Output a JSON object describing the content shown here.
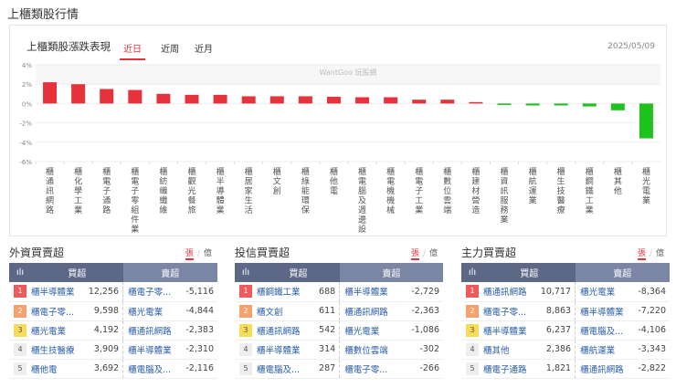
{
  "page_title": "上櫃類股行情",
  "card": {
    "title": "上櫃類股漲跌表現",
    "tabs": [
      "近日",
      "近周",
      "近月"
    ],
    "active_tab": 0,
    "date": "2025/05/09",
    "watermark": "WantGoo 玩股網"
  },
  "chart_data": {
    "type": "bar",
    "ylim": [
      -6,
      4
    ],
    "yticks": [
      "4%",
      "2%",
      "0%",
      "-2%",
      "-4%",
      "-6%"
    ],
    "ytick_values": [
      4,
      2,
      0,
      -2,
      -4,
      -6
    ],
    "categories": [
      "櫃通訊網路",
      "櫃化學工業",
      "櫃電子通路",
      "櫃電子零組件業",
      "櫃紡織纖維",
      "櫃觀光餐旅",
      "櫃半導體業",
      "櫃居家生活",
      "櫃文創",
      "櫃綠能環保",
      "櫃他電",
      "櫃電腦及週邊設",
      "櫃電機機械",
      "櫃電子工業",
      "櫃數位雲端",
      "櫃建材營造",
      "櫃資訊服務業",
      "櫃航運業",
      "櫃生技醫療",
      "櫃鋼鐵工業",
      "櫃其他",
      "櫃光電業"
    ],
    "values": [
      2.2,
      2.0,
      1.5,
      1.4,
      1.0,
      0.9,
      0.9,
      0.75,
      0.75,
      0.75,
      0.7,
      0.65,
      0.65,
      0.4,
      0.4,
      0.15,
      -0.15,
      -0.2,
      -0.2,
      -0.3,
      -0.7,
      -3.6
    ],
    "colors": {
      "up": "#e5323c",
      "down": "#1ec31e"
    }
  },
  "unit": {
    "on": "張",
    "sep": "/",
    "off": "億"
  },
  "sections": [
    {
      "title": "外資買賣超",
      "h_icon": "ılı",
      "h_buy": "買超",
      "h_sell": "賣超",
      "rows": [
        [
          "1",
          "櫃半導體業",
          "12,256",
          "櫃電子零...",
          "-5,116"
        ],
        [
          "2",
          "櫃電子零...",
          "9,598",
          "櫃光電業",
          "-4,844"
        ],
        [
          "3",
          "櫃光電業",
          "4,192",
          "櫃通訊網路",
          "-2,383"
        ],
        [
          "4",
          "櫃生技醫療",
          "3,909",
          "櫃半導體業",
          "-2,310"
        ],
        [
          "5",
          "櫃他電",
          "3,692",
          "櫃電腦及...",
          "-2,116"
        ]
      ]
    },
    {
      "title": "投信買賣超",
      "h_icon": "ılı",
      "h_buy": "買超",
      "h_sell": "賣超",
      "rows": [
        [
          "1",
          "櫃鋼鐵工業",
          "688",
          "櫃半導體業",
          "-2,729"
        ],
        [
          "2",
          "櫃文創",
          "611",
          "櫃通訊網路",
          "-2,363"
        ],
        [
          "3",
          "櫃通訊網路",
          "542",
          "櫃光電業",
          "-1,086"
        ],
        [
          "4",
          "櫃半導體業",
          "314",
          "櫃數位雲端",
          "-302"
        ],
        [
          "5",
          "櫃電腦及...",
          "287",
          "櫃電子零...",
          "-266"
        ]
      ]
    },
    {
      "title": "主力買賣超",
      "h_icon": "ılı",
      "h_buy": "買超",
      "h_sell": "賣超",
      "rows": [
        [
          "1",
          "櫃通訊網路",
          "10,717",
          "櫃光電業",
          "-8,364"
        ],
        [
          "2",
          "櫃電子零...",
          "8,863",
          "櫃半導體業",
          "-7,220"
        ],
        [
          "3",
          "櫃半導體業",
          "6,237",
          "櫃電腦及...",
          "-4,106"
        ],
        [
          "4",
          "櫃其他",
          "2,386",
          "櫃航運業",
          "-3,343"
        ],
        [
          "5",
          "櫃電子通路",
          "1,821",
          "櫃通訊網路",
          "-2,822"
        ]
      ]
    }
  ]
}
